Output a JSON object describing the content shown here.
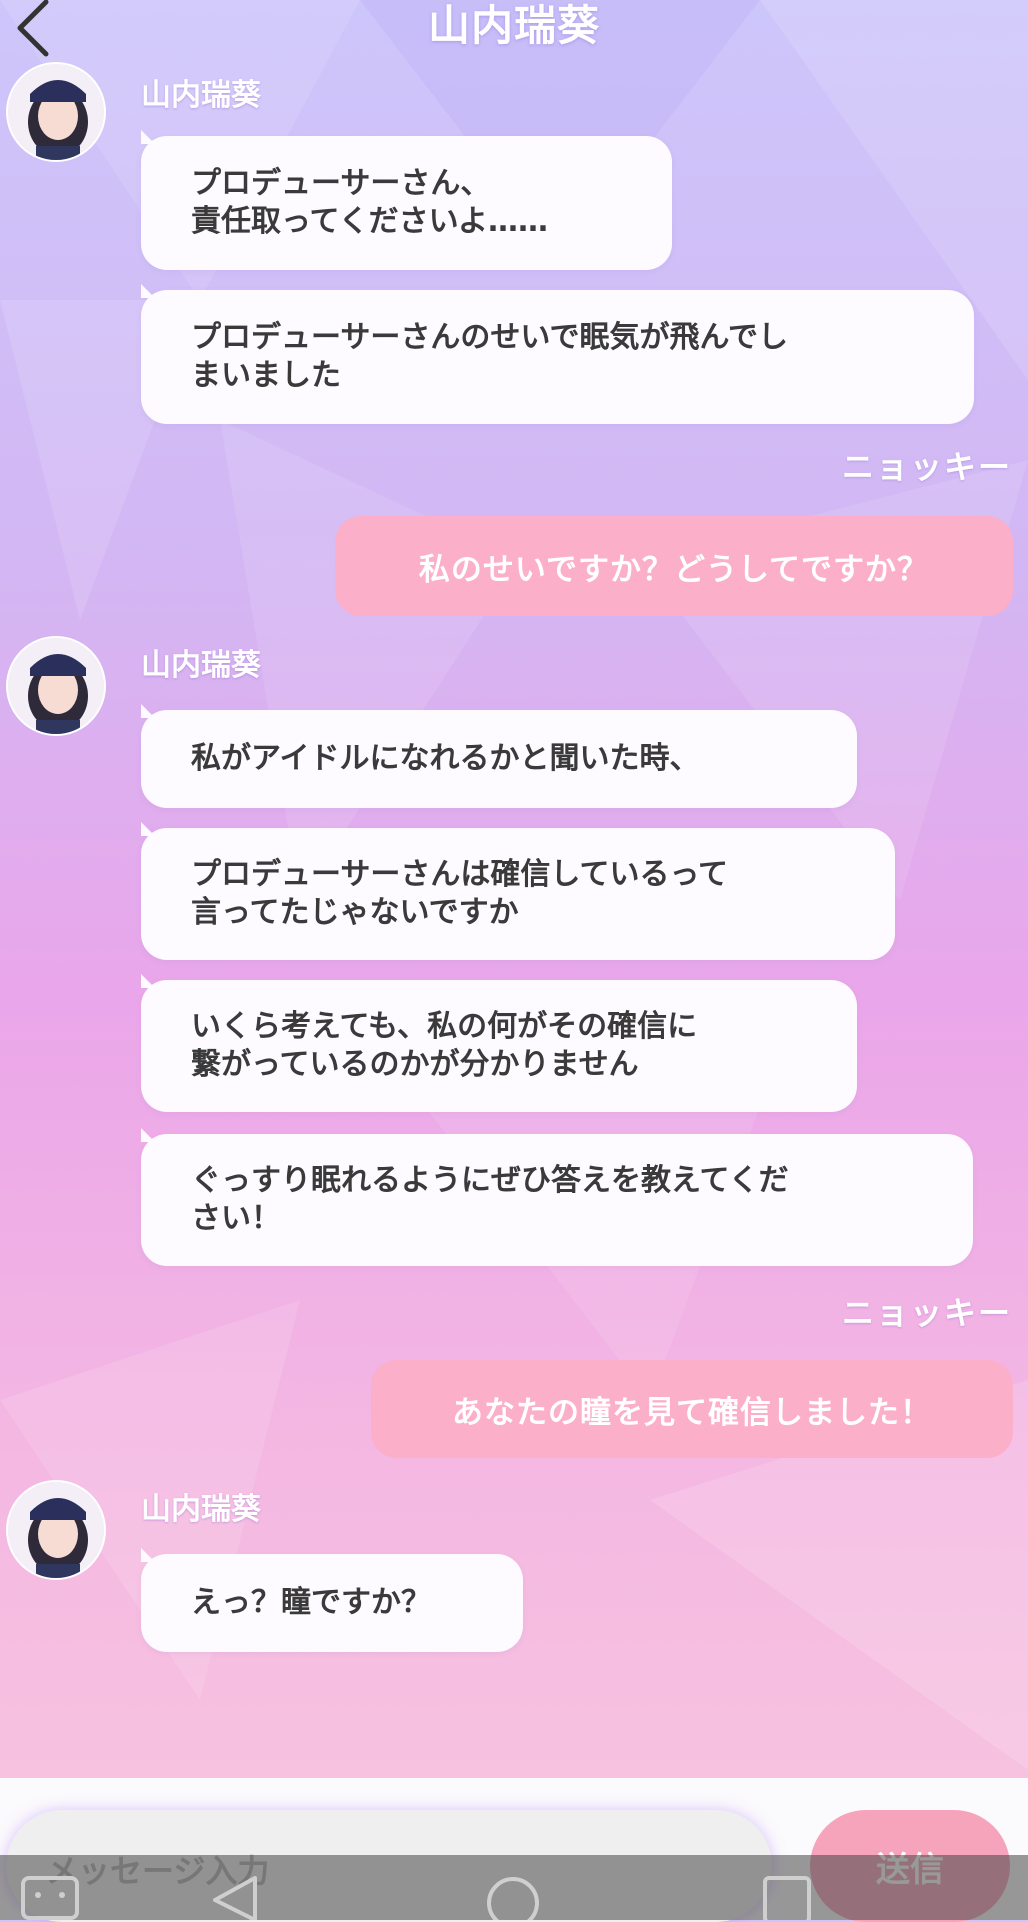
{
  "header": {
    "title": "山内瑞葵",
    "back_icon": "chevron-left-icon"
  },
  "messages": [
    {
      "type": "name",
      "text": "山内瑞葵"
    },
    {
      "type": "in",
      "text": "プロデューサーさん、\n責任取ってくださいよ……"
    },
    {
      "type": "in",
      "text": "プロデューサーさんのせいで眠気が飛んでし\nまいました"
    },
    {
      "type": "me-name",
      "text": "ニョッキー"
    },
    {
      "type": "out",
      "text": "私のせいですか？どうしてですか？"
    },
    {
      "type": "name",
      "text": "山内瑞葵"
    },
    {
      "type": "in",
      "text": "私がアイドルになれるかと聞いた時、"
    },
    {
      "type": "in",
      "text": "プロデューサーさんは確信しているって\n言ってたじゃないですか"
    },
    {
      "type": "in",
      "text": "いくら考えても、私の何がその確信に\n繋がっているのかが分かりません"
    },
    {
      "type": "in",
      "text": "ぐっすり眠れるようにぜひ答えを教えてくだ\nさい！"
    },
    {
      "type": "me-name",
      "text": "ニョッキー"
    },
    {
      "type": "out",
      "text": "あなたの瞳を見て確信しました！"
    },
    {
      "type": "name",
      "text": "山内瑞葵"
    },
    {
      "type": "in",
      "text": "えっ？瞳ですか？"
    }
  ],
  "composer": {
    "placeholder": "メッセージ入力",
    "send_label": "送信"
  },
  "colors": {
    "incoming": "#fdfbff",
    "outgoing": "#fbafc8",
    "send": "#f6a4bc"
  },
  "navbar": {
    "icons": [
      "keyboard-icon",
      "back-triangle-icon",
      "home-circle-icon",
      "recent-square-icon"
    ]
  }
}
